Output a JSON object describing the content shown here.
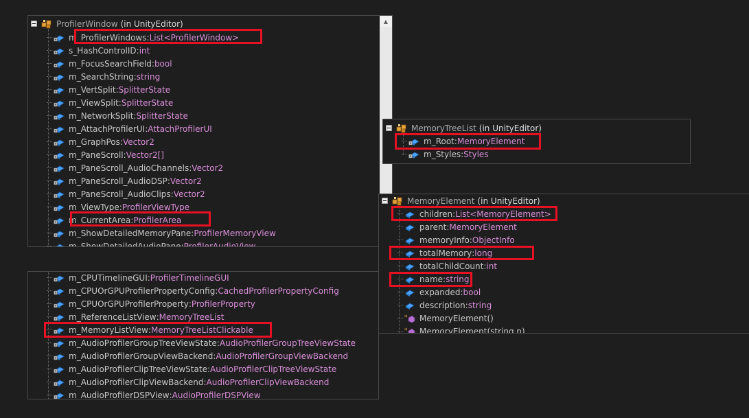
{
  "panel_profiler": {
    "title_class": "ProfilerWindow",
    "title_ns": "(in UnityEditor)",
    "header_icon": "class-icon",
    "rows": [
      {
        "name": "m_ProfilerWindows",
        "type": "List<ProfilerWindow>",
        "icon": "static-field-icon"
      },
      {
        "name": "s_HashControlID",
        "type": "int",
        "icon": "static-field-icon"
      },
      {
        "name": "m_FocusSearchField",
        "type": "bool",
        "icon": "private-field-icon"
      },
      {
        "name": "m_SearchString",
        "type": "string",
        "icon": "private-field-icon"
      },
      {
        "name": "m_VertSplit",
        "type": "SplitterState",
        "icon": "private-field-icon"
      },
      {
        "name": "m_ViewSplit",
        "type": "SplitterState",
        "icon": "private-field-icon"
      },
      {
        "name": "m_NetworkSplit",
        "type": "SplitterState",
        "icon": "private-field-icon"
      },
      {
        "name": "m_AttachProfilerUI",
        "type": "AttachProfilerUI",
        "icon": "private-field-icon"
      },
      {
        "name": "m_GraphPos",
        "type": "Vector2",
        "icon": "private-field-icon"
      },
      {
        "name": "m_PaneScroll",
        "type": "Vector2[]",
        "icon": "private-field-icon"
      },
      {
        "name": "m_PaneScroll_AudioChannels",
        "type": "Vector2",
        "icon": "private-field-icon"
      },
      {
        "name": "m_PaneScroll_AudioDSP",
        "type": "Vector2",
        "icon": "private-field-icon"
      },
      {
        "name": "m_PaneScroll_AudioClips",
        "type": "Vector2",
        "icon": "private-field-icon"
      },
      {
        "name": "m_ViewType",
        "type": "ProfilerViewType",
        "icon": "private-field-icon"
      },
      {
        "name": "m_CurrentArea",
        "type": "ProfilerArea",
        "icon": "private-field-icon"
      },
      {
        "name": "m_ShowDetailedMemoryPane",
        "type": "ProfilerMemoryView",
        "icon": "private-field-icon"
      },
      {
        "name": "m_ShowDetailedAudioPane",
        "type": "ProfilerAudioView",
        "icon": "private-field-icon"
      }
    ]
  },
  "panel_profiler_lower": {
    "rows": [
      {
        "name": "m_CPUTimelineGUI",
        "type": "ProfilerTimelineGUI",
        "icon": "private-field-icon"
      },
      {
        "name": "m_CPUOrGPUProfilerPropertyConfig",
        "type": "CachedProfilerPropertyConfig",
        "icon": "private-field-icon"
      },
      {
        "name": "m_CPUOrGPUProfilerProperty",
        "type": "ProfilerProperty",
        "icon": "private-field-icon"
      },
      {
        "name": "m_ReferenceListView",
        "type": "MemoryTreeList",
        "icon": "private-field-icon"
      },
      {
        "name": "m_MemoryListView",
        "type": "MemoryTreeListClickable",
        "icon": "private-field-icon"
      },
      {
        "name": "m_AudioProfilerGroupTreeViewState",
        "type": "AudioProfilerGroupTreeViewState",
        "icon": "private-field-icon"
      },
      {
        "name": "m_AudioProfilerGroupViewBackend",
        "type": "AudioProfilerGroupViewBackend",
        "icon": "private-field-icon"
      },
      {
        "name": "m_AudioProfilerClipTreeViewState",
        "type": "AudioProfilerClipTreeViewState",
        "icon": "private-field-icon"
      },
      {
        "name": "m_AudioProfilerClipViewBackend",
        "type": "AudioProfilerClipViewBackend",
        "icon": "private-field-icon"
      },
      {
        "name": "m_AudioProfilerDSPView",
        "type": "AudioProfilerDSPView",
        "icon": "private-field-icon"
      }
    ]
  },
  "panel_memorytreelist": {
    "title_class": "MemoryTreeList",
    "title_ns": "(in UnityEditor)",
    "header_icon": "class-icon",
    "rows": [
      {
        "name": "m_Root",
        "type": "MemoryElement",
        "icon": "private-field-icon"
      },
      {
        "name": "m_Styles",
        "type": "Styles",
        "icon": "static-field-icon"
      }
    ]
  },
  "panel_memoryelement": {
    "title_class": "MemoryElement",
    "title_ns": "(in UnityEditor)",
    "header_icon": "class-icon",
    "rows": [
      {
        "name": "children",
        "type": "List<MemoryElement>",
        "icon": "public-field-icon"
      },
      {
        "name": "parent",
        "type": "MemoryElement",
        "icon": "public-field-icon"
      },
      {
        "name": "memoryInfo",
        "type": "ObjectInfo",
        "icon": "public-field-icon"
      },
      {
        "name": "totalMemory",
        "type": "long",
        "icon": "public-field-icon"
      },
      {
        "name": "totalChildCount",
        "type": "int",
        "icon": "public-field-icon"
      },
      {
        "name": "name",
        "type": "string",
        "icon": "public-field-icon"
      },
      {
        "name": "expanded",
        "type": "bool",
        "icon": "public-field-icon"
      },
      {
        "name": "description",
        "type": "string",
        "icon": "public-field-icon"
      },
      {
        "name": "MemoryElement()",
        "type": "",
        "icon": "constructor-icon"
      },
      {
        "name": "MemoryElement(string n)",
        "type": "",
        "icon": "constructor-icon"
      }
    ]
  },
  "colors": {
    "background": "#1e1e1e",
    "text": "#c8c8c8",
    "type_text": "#d98fd9",
    "highlight": "#e81123",
    "icon_blue": "#3a8ee6"
  }
}
